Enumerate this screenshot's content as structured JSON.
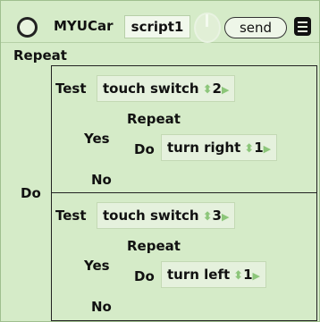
{
  "header": {
    "title": "MYUCar",
    "script_name": "script1",
    "send_label": "send"
  },
  "body": {
    "repeat_label": "Repeat",
    "do_label": "Do",
    "tests": [
      {
        "test_label": "Test",
        "condition": "touch switch",
        "condition_value": "2",
        "yes_label": "Yes",
        "no_label": "No",
        "inner_repeat_label": "Repeat",
        "inner_do_label": "Do",
        "action": "turn right",
        "action_count": "1"
      },
      {
        "test_label": "Test",
        "condition": "touch switch",
        "condition_value": "3",
        "yes_label": "Yes",
        "no_label": "No",
        "inner_repeat_label": "Repeat",
        "inner_do_label": "Do",
        "action": "turn left",
        "action_count": "1"
      }
    ]
  },
  "icons": {
    "menu": "menu-circle-icon",
    "knob": "rotate-knob-icon",
    "list": "list-menu-icon",
    "stepper": "up-down-arrows-icon",
    "next": "right-triangle-icon"
  },
  "colors": {
    "background": "#d5ebc8",
    "field": "#e5f1dd",
    "accent": "#8cc67a"
  }
}
